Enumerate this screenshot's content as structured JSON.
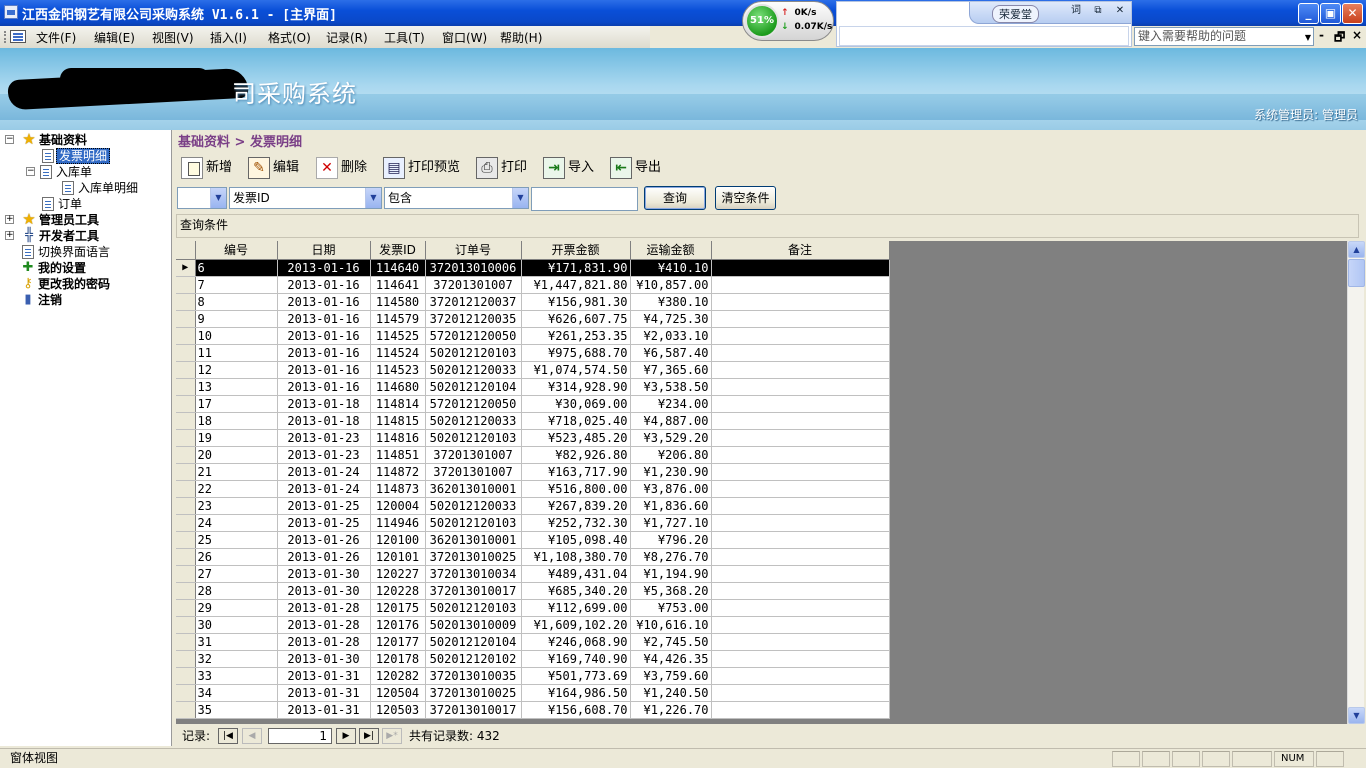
{
  "window": {
    "title": "江西金阳钢艺有限公司采购系统 V1.6.1 - [主界面]",
    "min_icon": "minimize-icon",
    "max_icon": "restore-icon",
    "close_icon": "close-icon"
  },
  "netmeter": {
    "percent": "51%",
    "up": "0K/s",
    "down": "0.07K/s"
  },
  "ime": {
    "user": "荣爱堂",
    "btn1": "词",
    "btn2": "⧉",
    "btn3": "✕"
  },
  "menu": {
    "items": [
      "文件(F)",
      "编辑(E)",
      "视图(V)",
      "插入(I)",
      "格式(O)",
      "记录(R)",
      "工具(T)",
      "窗口(W)",
      "帮助(H)"
    ],
    "help_placeholder": "键入需要帮助的问题",
    "ctrl_min": "-",
    "ctrl_restore": "🗗",
    "ctrl_close": "×"
  },
  "banner": {
    "title": "司采购系统",
    "user": "系统管理员: 管理员"
  },
  "tree": [
    {
      "label": "基础资料",
      "bold": true
    },
    {
      "label": "发票明细",
      "selected": true
    },
    {
      "label": "入库单"
    },
    {
      "label": "入库单明细"
    },
    {
      "label": "订单"
    },
    {
      "label": "管理员工具",
      "bold": true
    },
    {
      "label": "开发者工具",
      "bold": true
    },
    {
      "label": "切换界面语言"
    },
    {
      "label": "我的设置",
      "bold": true
    },
    {
      "label": "更改我的密码",
      "bold": true
    },
    {
      "label": "注销",
      "bold": true
    }
  ],
  "breadcrumb": "基础资料 > 发票明细",
  "toolbar": {
    "new": "新增",
    "edit": "编辑",
    "delete": "删除",
    "preview": "打印预览",
    "print": "打印",
    "import": "导入",
    "export": "导出"
  },
  "filter": {
    "field": "发票ID",
    "operator": "包含",
    "value": "",
    "query_btn": "查询",
    "clear_btn": "清空条件",
    "conditions_label": "查询条件"
  },
  "table": {
    "columns": [
      "编号",
      "日期",
      "发票ID",
      "订单号",
      "开票金额",
      "运输金额",
      "备注"
    ],
    "rows": [
      [
        "6",
        "2013-01-16",
        "114640",
        "372013010006",
        "¥171,831.90",
        "¥410.10",
        ""
      ],
      [
        "7",
        "2013-01-16",
        "114641",
        "37201301007",
        "¥1,447,821.80",
        "¥10,857.00",
        ""
      ],
      [
        "8",
        "2013-01-16",
        "114580",
        "372012120037",
        "¥156,981.30",
        "¥380.10",
        ""
      ],
      [
        "9",
        "2013-01-16",
        "114579",
        "372012120035",
        "¥626,607.75",
        "¥4,725.30",
        ""
      ],
      [
        "10",
        "2013-01-16",
        "114525",
        "572012120050",
        "¥261,253.35",
        "¥2,033.10",
        ""
      ],
      [
        "11",
        "2013-01-16",
        "114524",
        "502012120103",
        "¥975,688.70",
        "¥6,587.40",
        ""
      ],
      [
        "12",
        "2013-01-16",
        "114523",
        "502012120033",
        "¥1,074,574.50",
        "¥7,365.60",
        ""
      ],
      [
        "13",
        "2013-01-16",
        "114680",
        "502012120104",
        "¥314,928.90",
        "¥3,538.50",
        ""
      ],
      [
        "17",
        "2013-01-18",
        "114814",
        "572012120050",
        "¥30,069.00",
        "¥234.00",
        ""
      ],
      [
        "18",
        "2013-01-18",
        "114815",
        "502012120033",
        "¥718,025.40",
        "¥4,887.00",
        ""
      ],
      [
        "19",
        "2013-01-23",
        "114816",
        "502012120103",
        "¥523,485.20",
        "¥3,529.20",
        ""
      ],
      [
        "20",
        "2013-01-23",
        "114851",
        "37201301007",
        "¥82,926.80",
        "¥206.80",
        ""
      ],
      [
        "21",
        "2013-01-24",
        "114872",
        "37201301007",
        "¥163,717.90",
        "¥1,230.90",
        ""
      ],
      [
        "22",
        "2013-01-24",
        "114873",
        "362013010001",
        "¥516,800.00",
        "¥3,876.00",
        ""
      ],
      [
        "23",
        "2013-01-25",
        "120004",
        "502012120033",
        "¥267,839.20",
        "¥1,836.60",
        ""
      ],
      [
        "24",
        "2013-01-25",
        "114946",
        "502012120103",
        "¥252,732.30",
        "¥1,727.10",
        ""
      ],
      [
        "25",
        "2013-01-26",
        "120100",
        "362013010001",
        "¥105,098.40",
        "¥796.20",
        ""
      ],
      [
        "26",
        "2013-01-26",
        "120101",
        "372013010025",
        "¥1,108,380.70",
        "¥8,276.70",
        ""
      ],
      [
        "27",
        "2013-01-30",
        "120227",
        "372013010034",
        "¥489,431.04",
        "¥1,194.90",
        ""
      ],
      [
        "28",
        "2013-01-30",
        "120228",
        "372013010017",
        "¥685,340.20",
        "¥5,368.20",
        ""
      ],
      [
        "29",
        "2013-01-28",
        "120175",
        "502012120103",
        "¥112,699.00",
        "¥753.00",
        ""
      ],
      [
        "30",
        "2013-01-28",
        "120176",
        "502013010009",
        "¥1,609,102.20",
        "¥10,616.10",
        ""
      ],
      [
        "31",
        "2013-01-28",
        "120177",
        "502012120104",
        "¥246,068.90",
        "¥2,745.50",
        ""
      ],
      [
        "32",
        "2013-01-30",
        "120178",
        "502012120102",
        "¥169,740.90",
        "¥4,426.35",
        ""
      ],
      [
        "33",
        "2013-01-31",
        "120282",
        "372013010035",
        "¥501,773.69",
        "¥3,759.60",
        ""
      ],
      [
        "34",
        "2013-01-31",
        "120504",
        "372013010025",
        "¥164,986.50",
        "¥1,240.50",
        ""
      ],
      [
        "35",
        "2013-01-31",
        "120503",
        "372013010017",
        "¥156,608.70",
        "¥1,226.70",
        ""
      ]
    ]
  },
  "recnav": {
    "label": "记录:",
    "current": "1",
    "total": "共有记录数: 432"
  },
  "status": {
    "left": "窗体视图",
    "num": "NUM"
  }
}
